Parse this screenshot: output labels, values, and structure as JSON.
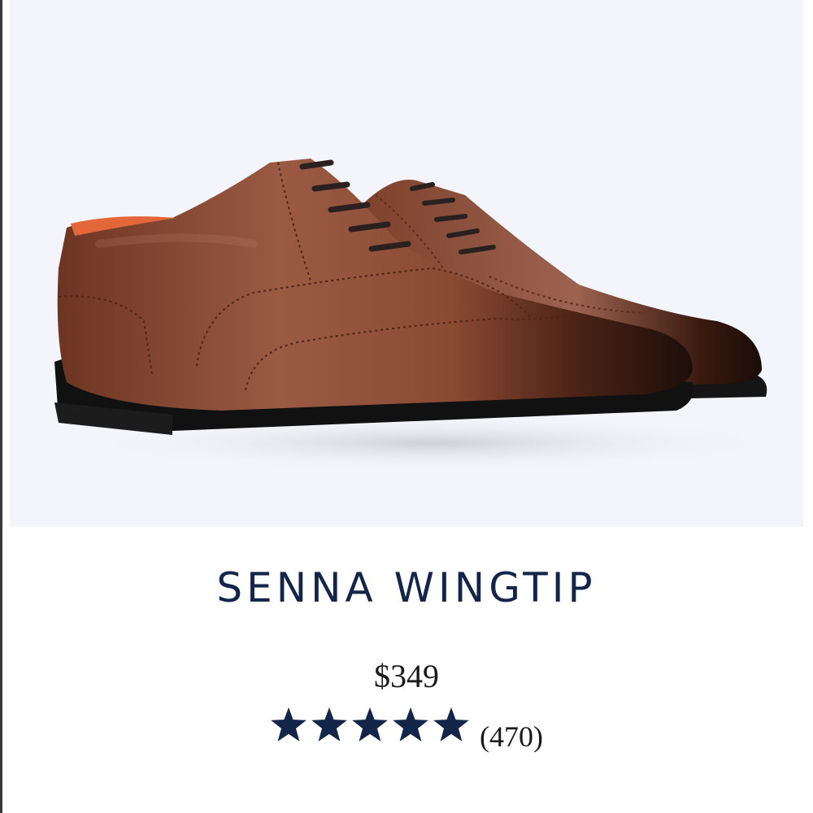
{
  "product": {
    "name": "SENNA WINGTIP",
    "price": "$349",
    "rating": {
      "stars": 5,
      "max_stars": 5,
      "review_count": "(470)"
    },
    "image": {
      "subject": "brown leather wingtip oxford shoes",
      "background_color": "#f3f5fa"
    }
  },
  "colors": {
    "title": "#14254a",
    "star": "#14254a",
    "text": "#1a1a1a",
    "leather": "#8a4a32",
    "sole": "#111111",
    "lining": "#e3673a"
  },
  "icons": {
    "star": "star-icon"
  }
}
